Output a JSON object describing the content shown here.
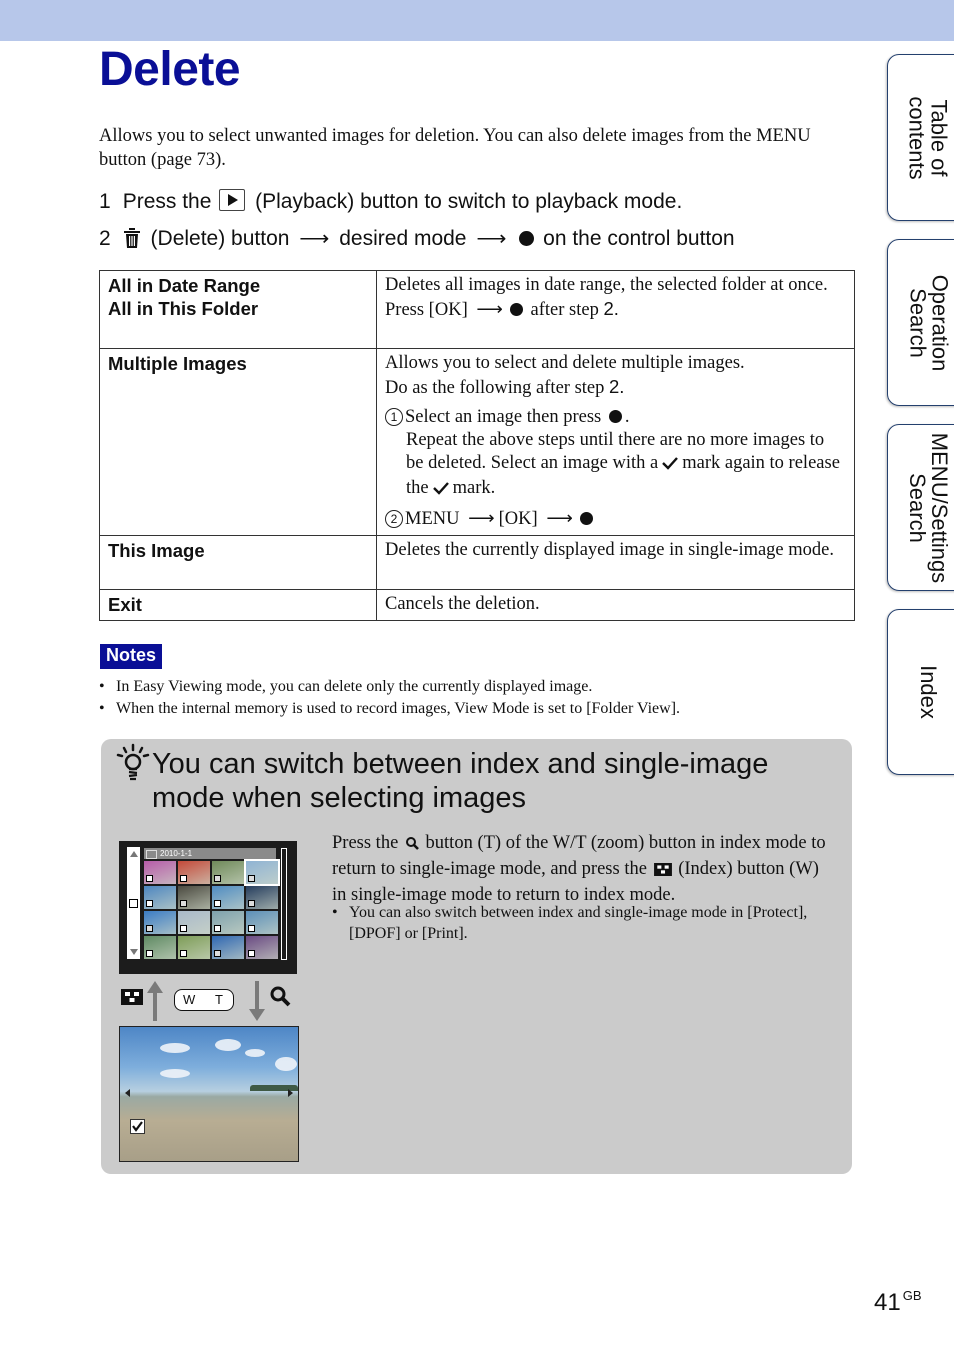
{
  "page": {
    "title": "Delete",
    "intro": "Allows you to select unwanted images for deletion. You can also delete images from the MENU button (page 73).",
    "steps": [
      {
        "num": "1",
        "pre": "Press the",
        "icon": "playback-icon",
        "post": "(Playback) button to switch to playback mode."
      },
      {
        "num": "2",
        "icon": "trash-icon",
        "part1": "(Delete) button",
        "part2": "desired mode",
        "part3": "on the control button"
      }
    ],
    "arrow": "⟶"
  },
  "table": {
    "rows": [
      {
        "keys": [
          "All in Date Range",
          "All in This Folder"
        ],
        "lines": [
          "Deletes all images in date range, the selected folder at once."
        ],
        "press_pre": "Press [OK]",
        "press_post": "after step",
        "press_step": "2."
      },
      {
        "keys": [
          "Multiple Images"
        ],
        "line1": "Allows you to select and delete multiple images.",
        "line2_pre": "Do as the following after step",
        "line2_step": "2.",
        "sub1_num": "1",
        "sub1_text": "Select an image then press",
        "sub1_cont_a": "Repeat the above steps until there are no more images to be deleted. Select an image with a",
        "sub1_cont_b": "mark again to release the",
        "sub1_cont_c": "mark.",
        "sub2_num": "2",
        "sub2_menu": "MENU",
        "sub2_ok": "[OK]"
      },
      {
        "keys": [
          "This Image"
        ],
        "lines": [
          "Deletes the currently displayed image in single-image mode."
        ]
      },
      {
        "keys": [
          "Exit"
        ],
        "lines": [
          "Cancels the deletion."
        ]
      }
    ]
  },
  "notes": {
    "label": "Notes",
    "items": [
      "In Easy Viewing mode, you can delete only the currently displayed image.",
      "When the internal memory is used to record images, View Mode is set to [Folder View]."
    ]
  },
  "tip": {
    "title": "You can switch between index and single-image mode when selecting images",
    "text_a": "Press the",
    "text_b": "button (T) of the W/T (zoom) button in index mode to return to single-image mode, and press the",
    "text_c": "(Index) button (W) in single-image mode to return to index mode.",
    "bullet": "You can also switch between index and single-image mode in [Protect], [DPOF] or [Print].",
    "index_screen": {
      "date": "2010-1-1",
      "thumb_colors": [
        "#b65ca8",
        "#c44a3a",
        "#6f8a5a",
        "#8fb3d4",
        "#4d86c0",
        "#4b4a40",
        "#4f8cc2",
        "#253d5e",
        "#3b7cc5",
        "#a9b9c9",
        "#7ea1ad",
        "#5c8fb8",
        "#5f8a63",
        "#7e9d58",
        "#2f67b2",
        "#6a4a83"
      ],
      "thumb_checked": [
        false,
        false,
        true,
        true,
        false,
        true,
        false,
        true,
        true,
        false,
        false,
        false,
        false,
        false,
        true,
        false
      ],
      "selected_index": 3
    },
    "wt_button": {
      "w": "W",
      "t": "T"
    }
  },
  "sidetabs": [
    {
      "label": "Table of\ncontents"
    },
    {
      "label": "Operation\nSearch"
    },
    {
      "label": "MENU/Settings\nSearch"
    },
    {
      "label": "Index"
    }
  ],
  "footer": {
    "page_number": "41",
    "suffix": "GB"
  }
}
